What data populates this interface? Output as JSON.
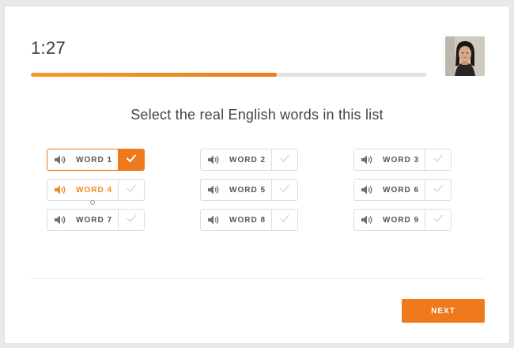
{
  "timer": {
    "value": "1:27"
  },
  "progress": {
    "fraction": 0.62
  },
  "instruction": "Select the real English words in this list",
  "words": [
    {
      "label": "WORD 1",
      "selected": true,
      "playing": false
    },
    {
      "label": "WORD 2",
      "selected": false,
      "playing": false
    },
    {
      "label": "WORD 3",
      "selected": false,
      "playing": false
    },
    {
      "label": "WORD 4",
      "selected": false,
      "playing": true
    },
    {
      "label": "WORD 5",
      "selected": false,
      "playing": false
    },
    {
      "label": "WORD 6",
      "selected": false,
      "playing": false
    },
    {
      "label": "WORD 7",
      "selected": false,
      "playing": false
    },
    {
      "label": "WORD 8",
      "selected": false,
      "playing": false
    },
    {
      "label": "WORD 9",
      "selected": false,
      "playing": false
    }
  ],
  "next_button": {
    "label": "NEXT"
  },
  "icons": {
    "speaker": "speaker-icon",
    "check": "checkmark-icon"
  },
  "colors": {
    "accent": "#ef7a1e",
    "speaker_idle": "#6f6f6f",
    "speaker_playing": "#f0891f",
    "check_idle": "#cfcfcf",
    "check_selected": "#ffffff"
  }
}
